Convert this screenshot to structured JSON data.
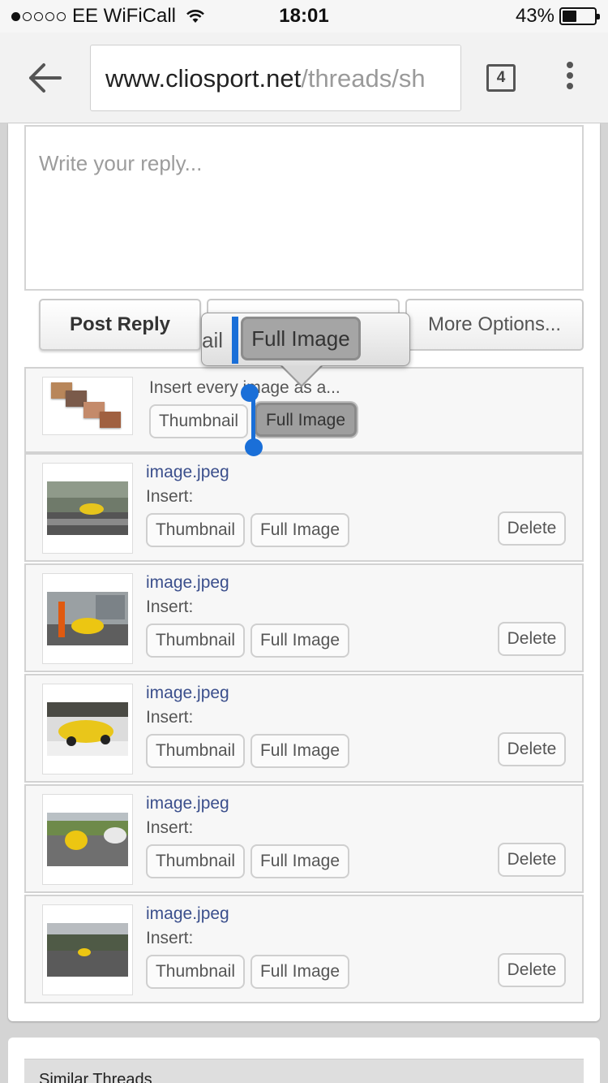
{
  "status_bar": {
    "carrier": "EE WiFiCall",
    "time": "18:01",
    "battery": "43%",
    "signal_bars": 1,
    "battery_level": 0.43
  },
  "browser": {
    "url_host": "www.cliosport.net",
    "url_path": "/threads/sh",
    "tab_count": "4"
  },
  "editor": {
    "placeholder": "Write your reply..."
  },
  "actions": {
    "post_reply": "Post Reply",
    "more_options": "More Options..."
  },
  "popup": {
    "fragment": "ail",
    "selected": "Full Image"
  },
  "insert_all": {
    "label": "Insert every image as a...",
    "thumbnail": "Thumbnail",
    "full_image": "Full Image"
  },
  "attachments": [
    {
      "filename": "image.jpeg",
      "insert_label": "Insert:",
      "thumbnail": "Thumbnail",
      "full_image": "Full Image",
      "delete": "Delete"
    },
    {
      "filename": "image.jpeg",
      "insert_label": "Insert:",
      "thumbnail": "Thumbnail",
      "full_image": "Full Image",
      "delete": "Delete"
    },
    {
      "filename": "image.jpeg",
      "insert_label": "Insert:",
      "thumbnail": "Thumbnail",
      "full_image": "Full Image",
      "delete": "Delete"
    },
    {
      "filename": "image.jpeg",
      "insert_label": "Insert:",
      "thumbnail": "Thumbnail",
      "full_image": "Full Image",
      "delete": "Delete"
    },
    {
      "filename": "image.jpeg",
      "insert_label": "Insert:",
      "thumbnail": "Thumbnail",
      "full_image": "Full Image",
      "delete": "Delete"
    }
  ],
  "similar_threads": {
    "title": "Similar Threads"
  },
  "colors": {
    "link": "#3b4f8c",
    "selection": "#1a6fd8",
    "selected_button": "#9e9e9e"
  }
}
